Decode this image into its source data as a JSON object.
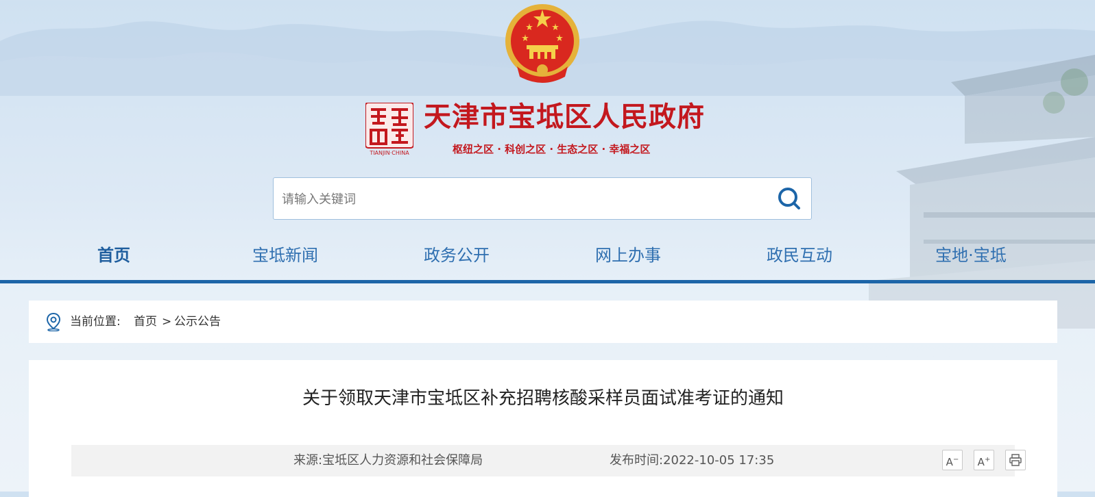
{
  "site": {
    "title": "天津市宝坻区人民政府",
    "slogan": "枢纽之区 · 科创之区 · 生态之区 · 幸福之区",
    "seal_text": "TIANJIN·CHINA"
  },
  "search": {
    "placeholder": "请输入关键词"
  },
  "nav": {
    "items": [
      {
        "label": "首页"
      },
      {
        "label": "宝坻新闻"
      },
      {
        "label": "政务公开"
      },
      {
        "label": "网上办事"
      },
      {
        "label": "政民互动"
      },
      {
        "label": "宝地·宝坻"
      }
    ]
  },
  "breadcrumb": {
    "label": "当前位置:",
    "home": "首页",
    "separator": ">",
    "current": "公示公告"
  },
  "article": {
    "title": "关于领取天津市宝坻区补充招聘核酸采样员面试准考证的通知",
    "source": "来源:宝坻区人力资源和社会保障局",
    "date": "发布时间:2022-10-05 17:35"
  },
  "tools": {
    "decrease_label": "A",
    "increase_label": "A"
  },
  "colors": {
    "brand_red": "#c3181e",
    "nav_blue": "#2f6fb0",
    "nav_line": "#1c65a8"
  }
}
